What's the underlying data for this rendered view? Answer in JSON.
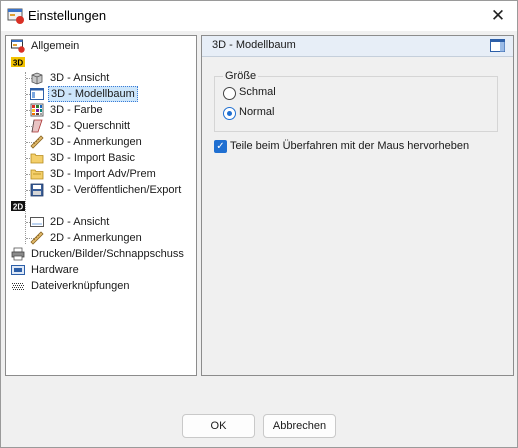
{
  "window": {
    "title": "Einstellungen",
    "close_glyph": "✕"
  },
  "tree": {
    "items": [
      {
        "label": "Allgemein",
        "icon": "general-settings-icon"
      },
      {
        "label": "",
        "icon": "3d-category-icon",
        "badge": "3D"
      },
      {
        "label": "3D - Ansicht",
        "icon": "3d-view-icon"
      },
      {
        "label": "3D - Modellbaum",
        "icon": "model-tree-icon",
        "selected": true
      },
      {
        "label": "3D - Farbe",
        "icon": "color-palette-icon"
      },
      {
        "label": "3D - Querschnitt",
        "icon": "cross-section-icon"
      },
      {
        "label": "3D - Anmerkungen",
        "icon": "annotation-ruler-icon"
      },
      {
        "label": "3D - Import Basic",
        "icon": "folder-import-icon"
      },
      {
        "label": "3D - Import Adv/Prem",
        "icon": "folder-import-advanced-icon"
      },
      {
        "label": "3D - Veröffentlichen/Export",
        "icon": "export-disk-icon"
      },
      {
        "label": "",
        "icon": "2d-category-icon",
        "badge": "2D"
      },
      {
        "label": "2D - Ansicht",
        "icon": "2d-view-icon"
      },
      {
        "label": "2D - Anmerkungen",
        "icon": "annotation-ruler-icon"
      },
      {
        "label": "Drucken/Bilder/Schnappschuss",
        "icon": "printer-icon"
      },
      {
        "label": "Hardware",
        "icon": "hardware-icon"
      },
      {
        "label": "Dateiverknüpfungen",
        "icon": "file-association-icon"
      }
    ]
  },
  "panel": {
    "title": "3D - Modellbaum",
    "size_group": {
      "legend": "Größe",
      "options": [
        {
          "label": "Schmal",
          "checked": false
        },
        {
          "label": "Normal",
          "checked": true
        }
      ]
    },
    "highlight_checkbox": {
      "label": "Teile beim Überfahren mit der Maus hervorheben",
      "checked": true
    }
  },
  "buttons": {
    "ok": "OK",
    "cancel": "Abbrechen"
  }
}
